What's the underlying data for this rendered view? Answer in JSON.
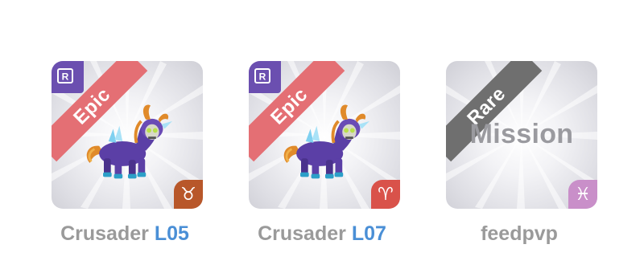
{
  "cards": [
    {
      "rarity": "Epic",
      "name": "Crusader",
      "level": "L05",
      "badge": "R",
      "zodiac_symbol": "♉",
      "zodiac_icon": "taurus-icon",
      "corner_color": "#b8572a"
    },
    {
      "rarity": "Epic",
      "name": "Crusader",
      "level": "L07",
      "badge": "R",
      "zodiac_symbol": "♈",
      "zodiac_icon": "aries-icon",
      "corner_color": "#d9524a"
    },
    {
      "rarity": "Rare",
      "name": "feedpvp",
      "overlay_text": "Mission",
      "zodiac_symbol": "♓",
      "zodiac_icon": "pisces-icon",
      "corner_color": "#c98fc9"
    }
  ],
  "colors": {
    "epic_ribbon": "#e46f74",
    "rare_ribbon": "#6f6f6f",
    "level_text": "#4a8fd6",
    "name_text": "#9a9a9a"
  }
}
